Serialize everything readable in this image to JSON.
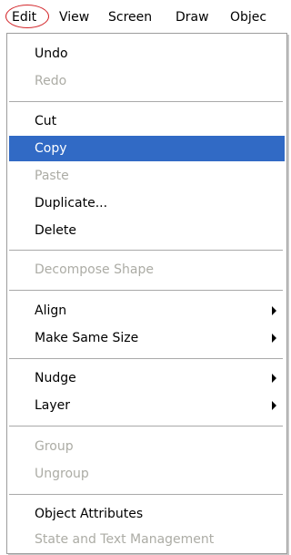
{
  "menubar": {
    "items": [
      "Edit",
      "View",
      "Screen",
      "Draw",
      "Objec"
    ]
  },
  "edit_menu": {
    "items": [
      {
        "label": "Undo",
        "enabled": true
      },
      {
        "label": "Redo",
        "enabled": false
      },
      {
        "label": "Cut",
        "enabled": true
      },
      {
        "label": "Copy",
        "enabled": true,
        "highlighted": true
      },
      {
        "label": "Paste",
        "enabled": false
      },
      {
        "label": "Duplicate...",
        "enabled": true
      },
      {
        "label": "Delete",
        "enabled": true
      },
      {
        "label": "Decompose Shape",
        "enabled": false
      },
      {
        "label": "Align",
        "enabled": true,
        "submenu": true
      },
      {
        "label": "Make Same Size",
        "enabled": true,
        "submenu": true
      },
      {
        "label": "Nudge",
        "enabled": true,
        "submenu": true
      },
      {
        "label": "Layer",
        "enabled": true,
        "submenu": true
      },
      {
        "label": "Group",
        "enabled": false
      },
      {
        "label": "Ungroup",
        "enabled": false
      },
      {
        "label": "Object Attributes",
        "enabled": true
      },
      {
        "label": "State and Text Management",
        "enabled": false
      }
    ]
  },
  "colors": {
    "highlight": "#316ac5",
    "disabled_text": "#acaca5",
    "annotation_circle": "#d3262a"
  }
}
